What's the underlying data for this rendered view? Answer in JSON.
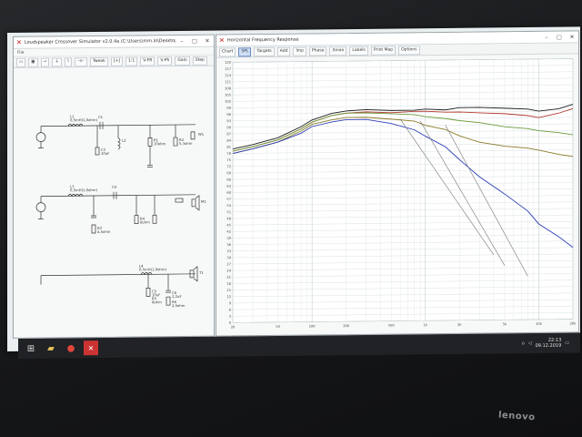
{
  "left_window": {
    "title": "Loudspeaker Crossover Simulator v2.0.4a (C:\\Users\\mm.lo\\Desktop...",
    "menu": "File",
    "toolbar": [
      "Tweak",
      "[+]",
      "1:1",
      "V-FR",
      "V-Ph",
      "Gain",
      "Step"
    ],
    "labels": {
      "c1": "C1",
      "c1_val": "22uF",
      "l1": "L1",
      "l1_val": "0,5mH(1,0ohm)",
      "l2": "L2",
      "c2": "C2",
      "r1": "R1",
      "c3": "C3",
      "c3_val": "10uF",
      "r1_val": "10ohm",
      "r2": "R2",
      "r2_val": "5,3ohm",
      "w1": "W1",
      "l3": "L3",
      "l3_val": "0,5mH(1,0ohm)",
      "c4": "C4",
      "c4_val": "4,7uF",
      "r3": "R3",
      "r3_val": "4,5ohm",
      "r4": "R4",
      "r4_val": "8ohm",
      "m1": "M1",
      "l4": "L4",
      "l4_val": "0,5mH(1,0ohm)",
      "c5": "C5",
      "c5_val": "10uF",
      "r5": "R5",
      "r5_val": "6ohm",
      "t1": "T1",
      "c6": "C6",
      "c6_val": "2,2uF",
      "r6": "R6",
      "r6_val": "2,5ohm"
    }
  },
  "right_window": {
    "title": "Horizontal Frequency Response",
    "toolbar": [
      "Chart",
      "SPL",
      "Targets",
      "Add",
      "Imp",
      "Phase",
      "Xmax",
      "Labels",
      "Print Map",
      "Options"
    ],
    "y_ticks": [
      "120",
      "117",
      "114",
      "111",
      "108",
      "105",
      "102",
      "99",
      "96",
      "93",
      "90",
      "87",
      "84",
      "81",
      "78",
      "75",
      "72",
      "69",
      "66",
      "63",
      "60",
      "57",
      "54",
      "51",
      "48",
      "45",
      "42",
      "39",
      "36",
      "33",
      "30",
      "27",
      "24",
      "21",
      "18",
      "15",
      "12",
      "9",
      "6",
      "3",
      "0"
    ],
    "x_ticks": [
      "20",
      "50",
      "100",
      "200",
      "500",
      "1k",
      "2k",
      "5k",
      "10k",
      "20k"
    ],
    "colors": {
      "black": "#1d1d1f",
      "red": "#b23a2e",
      "green": "#6c9b3a",
      "olive": "#8a7a28",
      "blue": "#2f3fb8",
      "grey": "#777777"
    }
  },
  "chart_data": {
    "type": "line",
    "title": "",
    "xlabel": "",
    "ylabel": "",
    "x_scale": "log",
    "xlim": [
      20,
      20000
    ],
    "ylim": [
      0,
      120
    ],
    "x": [
      20,
      30,
      50,
      80,
      100,
      150,
      200,
      300,
      500,
      800,
      1000,
      1500,
      2000,
      3000,
      5000,
      8000,
      10000,
      15000,
      20000
    ],
    "series": [
      {
        "values": [
          80,
          82,
          85,
          90,
          93,
          96,
          97,
          97.5,
          97,
          97,
          97.5,
          97,
          98,
          98,
          97.5,
          97,
          96,
          97,
          99
        ]
      },
      {
        "values": [
          79,
          81,
          84,
          89,
          92,
          95,
          96,
          96.5,
          96,
          96.5,
          96.5,
          96,
          96,
          95.5,
          95,
          94,
          93,
          95,
          97
        ]
      },
      {
        "values": [
          79,
          81,
          84,
          89,
          92,
          95,
          96,
          96,
          95.5,
          95,
          94,
          93,
          92,
          91,
          89,
          88,
          87,
          86,
          85
        ]
      },
      {
        "values": [
          78,
          80,
          83,
          88,
          91,
          93,
          94,
          94,
          93,
          92,
          90,
          88,
          85,
          82,
          80,
          79,
          78,
          76,
          75
        ]
      },
      {
        "values": [
          78,
          80,
          83,
          87,
          90,
          92,
          93,
          93,
          91,
          88,
          85,
          80,
          74,
          66,
          58,
          50,
          44,
          38,
          33
        ]
      }
    ]
  },
  "taskbar": {
    "time": "22:13",
    "date": "09.12.2019"
  },
  "brand": "lenovo"
}
